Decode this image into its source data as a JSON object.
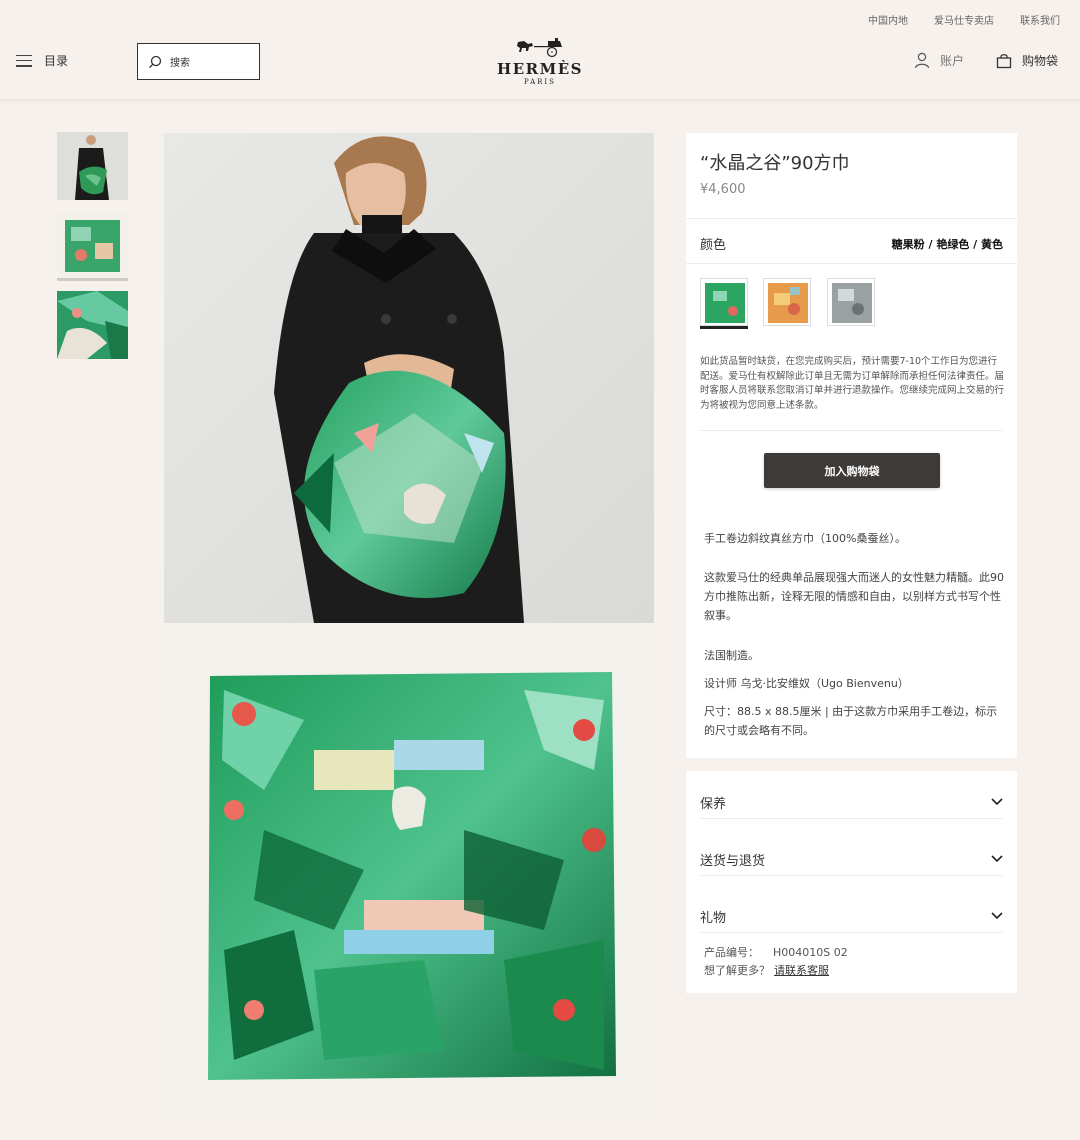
{
  "header": {
    "top_links": [
      "中国内地",
      "爱马仕专卖店",
      "联系我们"
    ],
    "menu_label": "目录",
    "search_placeholder": "搜索",
    "logo_text": "HERMÈS",
    "logo_sub": "PARIS",
    "account_label": "账户",
    "bag_label": "购物袋"
  },
  "product": {
    "title": "“水晶之谷”90方巾",
    "price": "¥4,600",
    "color_label": "颜色",
    "color_value": "糖果粉 / 艳绿色 / 黄色",
    "notice": "如此货品暂时缺货，在您完成购买后，预计需要7-10个工作日为您进行配送。爱马仕有权解除此订单且无需为订单解除而承担任何法律责任。届时客服人员将联系您取消订单并进行退款操作。您继续完成网上交易的行为将被视为您同意上述条款。",
    "add_button": "加入购物袋",
    "description": {
      "line1": "手工卷边斜纹真丝方巾（100%桑蚕丝）。",
      "line2": "这款爱马仕的经典单品展现强大而迷人的女性魅力精髓。此90方巾推陈出新，诠释无限的情感和自由，以别样方式书写个性叙事。",
      "line3": "法国制造。",
      "line4": "设计师 乌戈·比安维奴（Ugo Bienvenu）",
      "line5": "尺寸：88.5 x 88.5厘米 | 由于这款方巾采用手工卷边，标示的尺寸或会略有不同。"
    }
  },
  "accordion": {
    "care": "保养",
    "shipping": "送货与退货",
    "gift": "礼物"
  },
  "footer_info": {
    "product_number_label": "产品编号：",
    "product_number": "H004010S 02",
    "more_label": "想了解更多？",
    "contact_link": "请联系客服"
  },
  "colors": {
    "background": "#f6f1ec",
    "button": "#3d3a38"
  }
}
